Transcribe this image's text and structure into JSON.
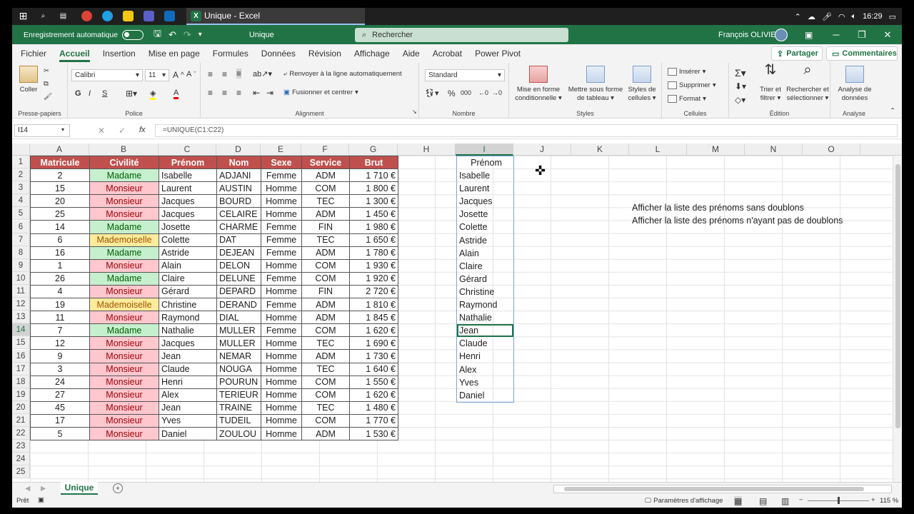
{
  "taskbar": {
    "active_window": "Unique - Excel",
    "time": "16:29"
  },
  "titlebar": {
    "autosave_label": "Enregistrement automatique",
    "doc_name": "Unique",
    "search_placeholder": "Rechercher",
    "user": "François OLIVIER"
  },
  "menu": {
    "tabs": [
      "Fichier",
      "Accueil",
      "Insertion",
      "Mise en page",
      "Formules",
      "Données",
      "Révision",
      "Affichage",
      "Aide",
      "Acrobat",
      "Power Pivot"
    ],
    "share": "Partager",
    "comments": "Commentaires"
  },
  "ribbon": {
    "clipboard": {
      "paste": "Coller",
      "label": "Presse-papiers"
    },
    "font": {
      "name": "Calibri",
      "size": "11",
      "label": "Police",
      "bold": "G",
      "italic": "I",
      "underline": "S"
    },
    "alignment": {
      "wrap": "Renvoyer à la ligne automatiquement",
      "merge": "Fusionner et centrer",
      "label": "Alignment"
    },
    "number": {
      "format": "Standard",
      "label": "Nombre"
    },
    "styles": {
      "cond": "Mise en forme conditionnelle",
      "table": "Mettre sous forme de tableau",
      "cell": "Styles de cellules",
      "label": "Styles"
    },
    "cells": {
      "insert": "Insérer",
      "delete": "Supprimer",
      "format": "Format",
      "label": "Cellules"
    },
    "editing": {
      "sort": "Trier et filtrer",
      "find": "Rechercher et sélectionner",
      "label": "Édition"
    },
    "analysis": {
      "analyze": "Analyse de données",
      "label": "Analyse"
    }
  },
  "formula": {
    "cell_ref": "I14",
    "formula": "=UNIQUE(C1:C22)"
  },
  "columns": [
    "A",
    "B",
    "C",
    "D",
    "E",
    "F",
    "G",
    "H",
    "I",
    "J",
    "K",
    "L",
    "M",
    "N",
    "O"
  ],
  "table": {
    "headers": [
      "Matricule",
      "Civilité",
      "Prénom",
      "Nom",
      "Sexe",
      "Service",
      "Brut"
    ],
    "rows": [
      [
        "2",
        "Madame",
        "Isabelle",
        "ADJANI",
        "Femme",
        "ADM",
        "1 710 €"
      ],
      [
        "15",
        "Monsieur",
        "Laurent",
        "AUSTIN",
        "Homme",
        "COM",
        "1 800 €"
      ],
      [
        "20",
        "Monsieur",
        "Jacques",
        "BOURD",
        "Homme",
        "TEC",
        "1 300 €"
      ],
      [
        "25",
        "Monsieur",
        "Jacques",
        "CELAIRE",
        "Homme",
        "ADM",
        "1 450 €"
      ],
      [
        "14",
        "Madame",
        "Josette",
        "CHARME",
        "Femme",
        "FIN",
        "1 980 €"
      ],
      [
        "6",
        "Mademoiselle",
        "Colette",
        "DAT",
        "Femme",
        "TEC",
        "1 650 €"
      ],
      [
        "16",
        "Madame",
        "Astride",
        "DEJEAN",
        "Femme",
        "ADM",
        "1 780 €"
      ],
      [
        "1",
        "Monsieur",
        "Alain",
        "DELON",
        "Homme",
        "COM",
        "1 930 €"
      ],
      [
        "26",
        "Madame",
        "Claire",
        "DELUNE",
        "Femme",
        "COM",
        "1 920 €"
      ],
      [
        "4",
        "Monsieur",
        "Gérard",
        "DEPARD",
        "Homme",
        "FIN",
        "2 720 €"
      ],
      [
        "19",
        "Mademoiselle",
        "Christine",
        "DERAND",
        "Femme",
        "ADM",
        "1 810 €"
      ],
      [
        "11",
        "Monsieur",
        "Raymond",
        "DIAL",
        "Homme",
        "ADM",
        "1 845 €"
      ],
      [
        "7",
        "Madame",
        "Nathalie",
        "MULLER",
        "Femme",
        "COM",
        "1 620 €"
      ],
      [
        "12",
        "Monsieur",
        "Jacques",
        "MULLER",
        "Homme",
        "TEC",
        "1 690 €"
      ],
      [
        "9",
        "Monsieur",
        "Jean",
        "NEMAR",
        "Homme",
        "ADM",
        "1 730 €"
      ],
      [
        "3",
        "Monsieur",
        "Claude",
        "NOUGA",
        "Homme",
        "TEC",
        "1 640 €"
      ],
      [
        "24",
        "Monsieur",
        "Henri",
        "POURUN",
        "Homme",
        "COM",
        "1 550 €"
      ],
      [
        "27",
        "Monsieur",
        "Alex",
        "TERIEUR",
        "Homme",
        "COM",
        "1 620 €"
      ],
      [
        "45",
        "Monsieur",
        "Jean",
        "TRAINE",
        "Homme",
        "TEC",
        "1 480 €"
      ],
      [
        "17",
        "Monsieur",
        "Yves",
        "TUDEIL",
        "Homme",
        "COM",
        "1 770 €"
      ],
      [
        "5",
        "Monsieur",
        "Daniel",
        "ZOULOU",
        "Homme",
        "ADM",
        "1 530 €"
      ]
    ]
  },
  "unique_list": [
    "Prénom",
    "Isabelle",
    "Laurent",
    "Jacques",
    "Josette",
    "Colette",
    "Astride",
    "Alain",
    "Claire",
    "Gérard",
    "Christine",
    "Raymond",
    "Nathalie",
    "Jean",
    "Claude",
    "Henri",
    "Alex",
    "Yves",
    "Daniel"
  ],
  "notes": [
    "Afficher la liste des prénoms sans doublons",
    "Afficher la liste des prénoms n'ayant pas de doublons"
  ],
  "sheet": {
    "tab": "Unique"
  },
  "status": {
    "ready": "Prêt",
    "display_settings": "Paramètres d'affichage",
    "zoom": "115 %"
  }
}
